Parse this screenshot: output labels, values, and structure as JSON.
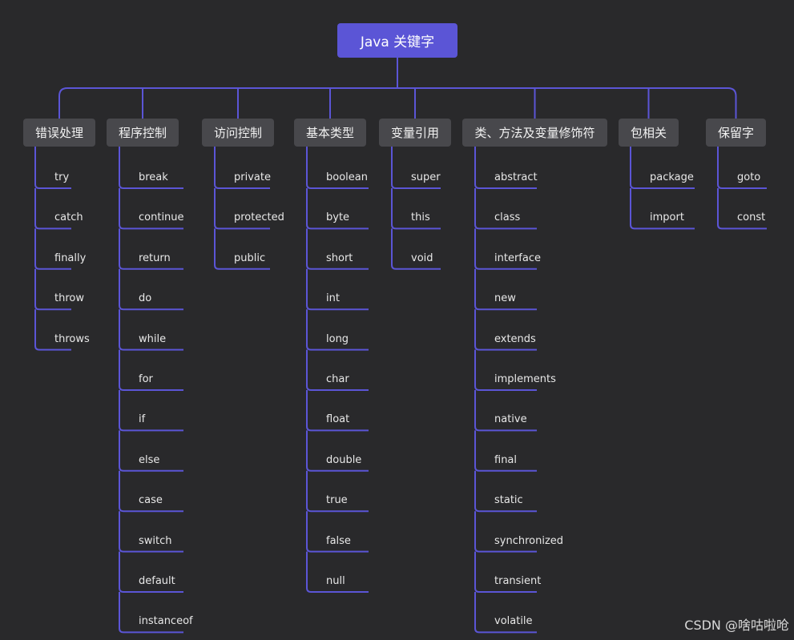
{
  "root": {
    "label": "Java 关键字"
  },
  "categories": [
    {
      "label": "错误处理",
      "items": [
        "try",
        "catch",
        "finally",
        "throw",
        "throws"
      ]
    },
    {
      "label": "程序控制",
      "items": [
        "break",
        "continue",
        "return",
        "do",
        "while",
        "for",
        "if",
        "else",
        "case",
        "switch",
        "default",
        "instanceof"
      ]
    },
    {
      "label": "访问控制",
      "items": [
        "private",
        "protected",
        "public"
      ]
    },
    {
      "label": "基本类型",
      "items": [
        "boolean",
        "byte",
        "short",
        "int",
        "long",
        "char",
        "float",
        "double",
        "true",
        "false",
        "null"
      ]
    },
    {
      "label": "变量引用",
      "items": [
        "super",
        "this",
        "void"
      ]
    },
    {
      "label": "类、方法及变量修饰符",
      "items": [
        "abstract",
        "class",
        "interface",
        "new",
        "extends",
        "implements",
        "native",
        "final",
        "static",
        "synchronized",
        "transient",
        "volatile"
      ]
    },
    {
      "label": "包相关",
      "items": [
        "package",
        "import"
      ]
    },
    {
      "label": "保留字",
      "items": [
        "goto",
        "const"
      ]
    }
  ],
  "watermark": "CSDN @啥咕啦呛",
  "colors": {
    "background": "#29292b",
    "root_fill": "#5b55d6",
    "category_fill": "#48484c",
    "connector": "#5b55d6"
  }
}
